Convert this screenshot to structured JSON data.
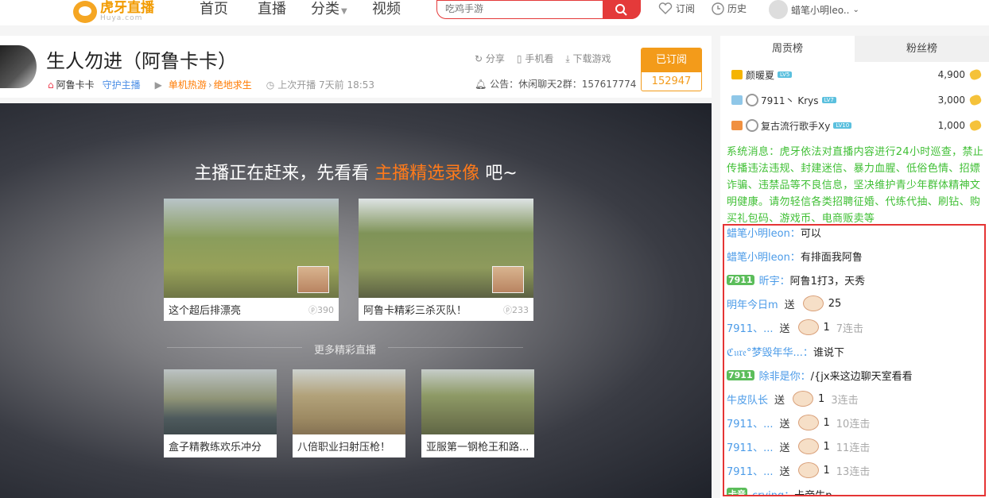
{
  "nav": {
    "logo_cn": "虎牙直播",
    "logo_en": "Huya.com",
    "items": [
      "首页",
      "直播",
      "分类",
      "视频"
    ],
    "search_placeholder": "吃鸡手游",
    "subscribe": "订阅",
    "history": "历史",
    "user": "蜡笔小明leo.."
  },
  "room": {
    "title": "生人勿进（阿鲁卡卡）",
    "anchor": "阿鲁卡卡",
    "guard": "守护主播",
    "category": "单机热游",
    "game": "绝地求生",
    "last_live": "上次开播 7天前 18:53",
    "share": "分享",
    "mobile": "手机看",
    "download": "下载游戏",
    "notice": "公告：休闲聊天2群：157617774",
    "subscribed_label": "已订阅",
    "subscriber_count": "152947"
  },
  "player": {
    "headline_pre": "主播正在赶来，先看看",
    "headline_highlight": "主播精选录像",
    "headline_post": "吧~",
    "featured": [
      {
        "title": "这个超后排漂亮",
        "views": "ⓟ390"
      },
      {
        "title": "阿鲁卡精彩三杀灭队！",
        "views": "ⓟ233"
      }
    ],
    "more_title": "更多精彩直播",
    "more": [
      {
        "title": "盒子精教练欢乐冲分"
      },
      {
        "title": "八倍职业扫射压枪！"
      },
      {
        "title": "亚服第一钢枪王和路..."
      }
    ]
  },
  "rank": {
    "tabs": [
      "周贡榜",
      "粉丝榜"
    ],
    "rows": [
      {
        "name": "颜暖夏",
        "level": "LV5",
        "score": "4,900",
        "medal_color": "#f5b400"
      },
      {
        "name": "7911丶 Krys",
        "level": "LV7",
        "score": "3,000",
        "medal_color": "#8fc7e8"
      },
      {
        "name": "复古流行歌手Xy",
        "level": "LV10",
        "score": "1,000",
        "medal_color": "#f09040"
      }
    ]
  },
  "system_message": "系统消息：虎牙依法对直播内容进行24小时巡查，禁止传播违法违规、封建迷信、暴力血腥、低俗色情、招嫖诈骗、违禁品等不良信息，坚决维护青少年群体精神文明健康。请勿轻信各类招聘征婚、代练代抽、刷钻、购买礼包码、游戏币、电商贩卖等",
  "chat": [
    {
      "user": "蜡笔小明leon：",
      "text": "可以"
    },
    {
      "user": "蜡笔小明leon：",
      "text": "有排面我阿鲁"
    },
    {
      "badge": "7911",
      "user": "昕宇：",
      "text": "阿鲁1打3，天秀"
    },
    {
      "user": "明年今日m",
      "send": "送",
      "count": "25"
    },
    {
      "user": "7911、...",
      "send": "送",
      "count": "1",
      "combo": "7连击"
    },
    {
      "user": "ℭ𝔲𝔯𝔢°梦毁年华...：",
      "text": "谁说下"
    },
    {
      "badge": "7911",
      "user": "除非是你：",
      "text": "/{jx来这边聊天室看看"
    },
    {
      "user": "牛皮队长",
      "send": "送",
      "count": "1",
      "combo": "3连击"
    },
    {
      "user": "7911、...",
      "send": "送",
      "count": "1",
      "combo": "10连击"
    },
    {
      "user": "7911、...",
      "send": "送",
      "count": "1",
      "combo": "11连击"
    },
    {
      "user": "7911、...",
      "send": "送",
      "count": "1",
      "combo": "13连击"
    },
    {
      "badge": "卡音",
      "user": "crying：",
      "text": "卡帝牛p"
    }
  ]
}
